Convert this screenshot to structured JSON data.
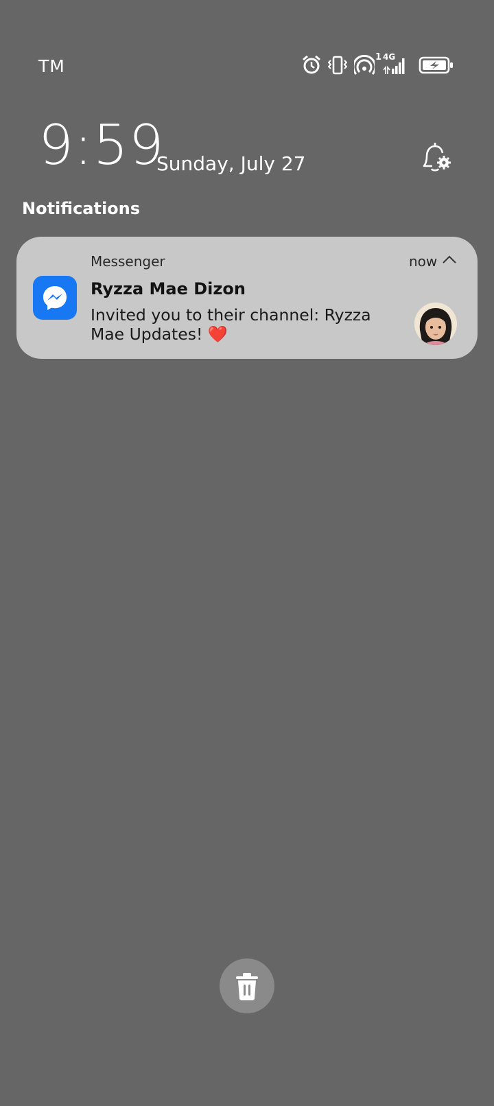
{
  "status_bar": {
    "carrier": "TM",
    "sim_slot": "1",
    "network_type": "4G",
    "icons": [
      "alarm-icon",
      "vibrate-icon",
      "hotspot-icon",
      "signal-icon",
      "battery-charging-icon"
    ]
  },
  "lockscreen": {
    "time": "9:59",
    "date": "Sunday, July 27"
  },
  "notifications": {
    "section_label": "Notifications",
    "items": [
      {
        "app_name": "Messenger",
        "app_icon": "messenger-icon",
        "time": "now",
        "sender": "Ryzza Mae Dizon",
        "message": "Invited you to their channel: Ryzza Mae Updates!",
        "emoji": "❤️"
      }
    ]
  },
  "actions": {
    "clear_icon": "trash-icon"
  },
  "colors": {
    "background": "#666666",
    "card": "#c8c8c8",
    "messenger_blue": "#1877f2"
  }
}
